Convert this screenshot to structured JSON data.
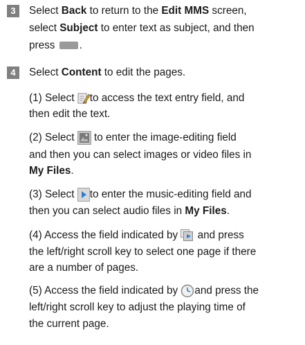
{
  "step3": {
    "number": "3",
    "l1a": "Select ",
    "l1b": "Back",
    "l1c": " to return to the ",
    "l1d": "Edit MMS",
    "l1e": " screen,",
    "l2a": "select ",
    "l2b": "Subject",
    "l2c": " to enter text as subject, and then",
    "l3a": "press",
    "l3b": "."
  },
  "step4": {
    "number": "4",
    "l1a": "Select ",
    "l1b": "Content",
    "l1c": " to edit the pages.",
    "s1a": "(1) Select ",
    "s1b": "to access the text entry field, and",
    "s1c": "then edit the text.",
    "s2a": "(2) Select ",
    "s2b": " to enter the image-editing field",
    "s2c": "and then you can select images or video files in",
    "s2d": "My Files",
    "s2e": ".",
    "s3a": "(3) Select ",
    "s3b": "to enter the music-editing field and",
    "s3c": "then you can select audio files in ",
    "s3d": "My Files",
    "s3e": ".",
    "s4a": "(4) Access the field indicated by ",
    "s4b": " and press",
    "s4c": "the left/right scroll key to select one page if there",
    "s4d": "are a number of pages.",
    "s5a": "(5) Access the field indicated by ",
    "s5b": "and press the",
    "s5c": "left/right scroll key to adjust the playing time of",
    "s5d": "the current page."
  }
}
